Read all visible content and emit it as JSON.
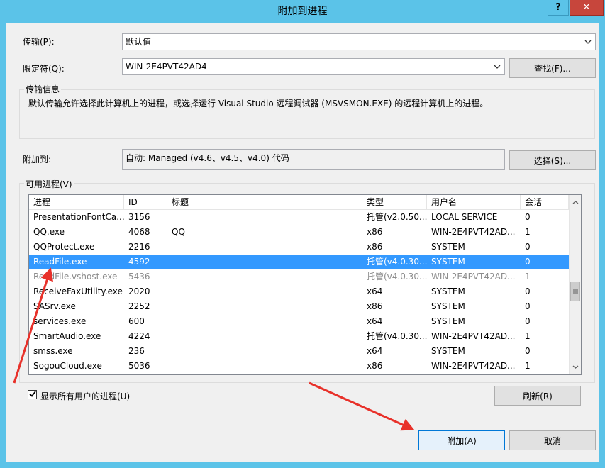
{
  "window": {
    "title": "附加到进程",
    "help_label": "?",
    "close_label": "✕"
  },
  "transport": {
    "label": "传输(P):",
    "value": "默认值"
  },
  "qualifier": {
    "label": "限定符(Q):",
    "value": "WIN-2E4PVT42AD4",
    "find_button": "查找(F)..."
  },
  "transport_info": {
    "title": "传输信息",
    "text": "默认传输允许选择此计算机上的进程，或选择运行 Visual Studio 远程调试器 (MSVSMON.EXE) 的远程计算机上的进程。"
  },
  "attach_to": {
    "label": "附加到:",
    "value": "自动: Managed (v4.6、v4.5、v4.0) 代码",
    "select_button": "选择(S)..."
  },
  "processes": {
    "title": "可用进程(V)",
    "columns": [
      "进程",
      "ID",
      "标题",
      "类型",
      "用户名",
      "会话"
    ],
    "rows": [
      [
        "PresentationFontCa...",
        "3156",
        "",
        "托管(v2.0.50...",
        "LOCAL SERVICE",
        "0"
      ],
      [
        "QQ.exe",
        "4068",
        "QQ",
        "x86",
        "WIN-2E4PVT42AD...",
        "1"
      ],
      [
        "QQProtect.exe",
        "2216",
        "",
        "x86",
        "SYSTEM",
        "0"
      ],
      [
        "ReadFile.exe",
        "4592",
        "",
        "托管(v4.0.30...",
        "SYSTEM",
        "0"
      ],
      [
        "ReadFile.vshost.exe",
        "5436",
        "",
        "托管(v4.0.30...",
        "WIN-2E4PVT42AD...",
        "1"
      ],
      [
        "ReceiveFaxUtility.exe",
        "2020",
        "",
        "x64",
        "SYSTEM",
        "0"
      ],
      [
        "SASrv.exe",
        "2252",
        "",
        "x86",
        "SYSTEM",
        "0"
      ],
      [
        "services.exe",
        "600",
        "",
        "x64",
        "SYSTEM",
        "0"
      ],
      [
        "SmartAudio.exe",
        "4224",
        "",
        "托管(v4.0.30...",
        "WIN-2E4PVT42AD...",
        "1"
      ],
      [
        "smss.exe",
        "236",
        "",
        "x64",
        "SYSTEM",
        "0"
      ],
      [
        "SogouCloud.exe",
        "5036",
        "",
        "x86",
        "WIN-2E4PVT42AD...",
        "1"
      ]
    ],
    "selected_row": 3,
    "grey_row": 4
  },
  "show_all": {
    "label": "显示所有用户的进程(U)",
    "checked": true
  },
  "buttons": {
    "refresh": "刷新(R)",
    "attach": "附加(A)",
    "cancel": "取消"
  },
  "colors": {
    "title_bar": "#5bc3e8",
    "selection": "#3399ff",
    "annotation": "#e8312a"
  },
  "icons": {
    "dropdown": "chevron-down-icon",
    "check": "checkmark-icon",
    "scroll_up": "scroll-up-icon",
    "scroll_down": "scroll-down-icon"
  }
}
